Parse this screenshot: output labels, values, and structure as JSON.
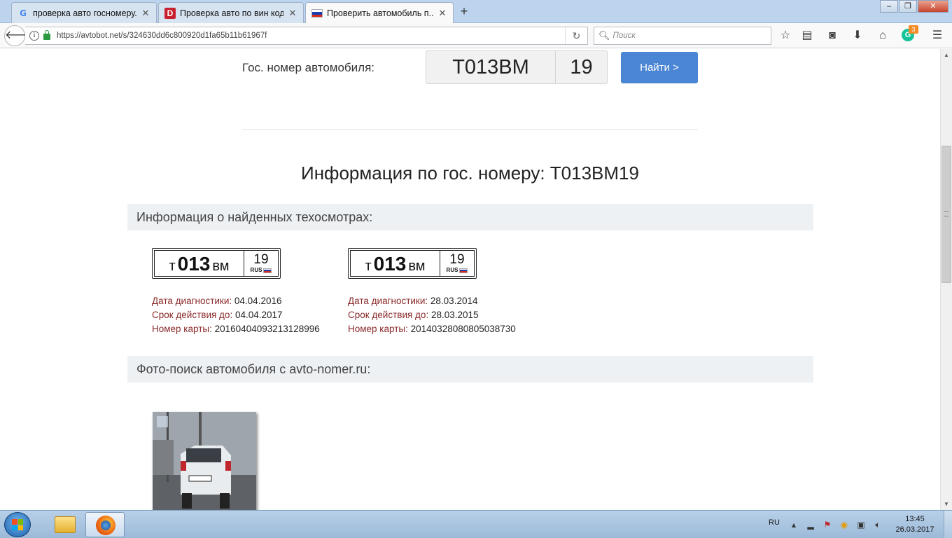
{
  "browser": {
    "tabs": [
      {
        "title": "проверка авто госномеру...",
        "favicon": "google-icon",
        "favicon_text": "G",
        "active": false
      },
      {
        "title": "Проверка авто по вин код...",
        "favicon": "drom-icon",
        "favicon_text": "D",
        "active": false
      },
      {
        "title": "Проверить автомобиль п...",
        "favicon": "russia-flag-icon",
        "active": true
      }
    ],
    "new_tab": "+",
    "window_controls": {
      "minimize": "–",
      "restore": "❐",
      "close": "✕"
    },
    "url": "https://avtobot.net/s/324630dd6c800920d1fa65b11b61967f",
    "search_placeholder": "Поиск",
    "grammarly_count": "3",
    "grammarly_letter": "G"
  },
  "search_form": {
    "label": "Гос. номер автомобиля:",
    "plate_number": "Т013ВМ",
    "plate_region": "19",
    "button": "Найти >"
  },
  "result": {
    "title": "Информация по гос. номеру: Т013ВМ19"
  },
  "inspections": {
    "header": "Информация о найденных техосмотрах:",
    "date_label": "Дата диагностики:",
    "valid_label": "Срок действия до:",
    "card_label": "Номер карты:",
    "items": [
      {
        "plate_letter1": "т",
        "plate_digits": "013",
        "plate_letters2": "вм",
        "plate_region": "19",
        "plate_country": "RUS",
        "date": "04.04.2016",
        "valid_until": "04.04.2017",
        "card": "20160404093213128996"
      },
      {
        "plate_letter1": "т",
        "plate_digits": "013",
        "plate_letters2": "вм",
        "plate_region": "19",
        "plate_country": "RUS",
        "date": "28.03.2014",
        "valid_until": "28.03.2015",
        "card": "20140328080805038730"
      }
    ]
  },
  "photo_search": {
    "header": "Фото-поиск автомобиля с avto-nomer.ru:"
  },
  "taskbar": {
    "language": "RU",
    "time": "13:45",
    "date": "26.03.2017"
  },
  "colors": {
    "accent_button": "#4a86d4",
    "label_red": "#8a2a2a",
    "section_bg": "#eef1f4"
  }
}
